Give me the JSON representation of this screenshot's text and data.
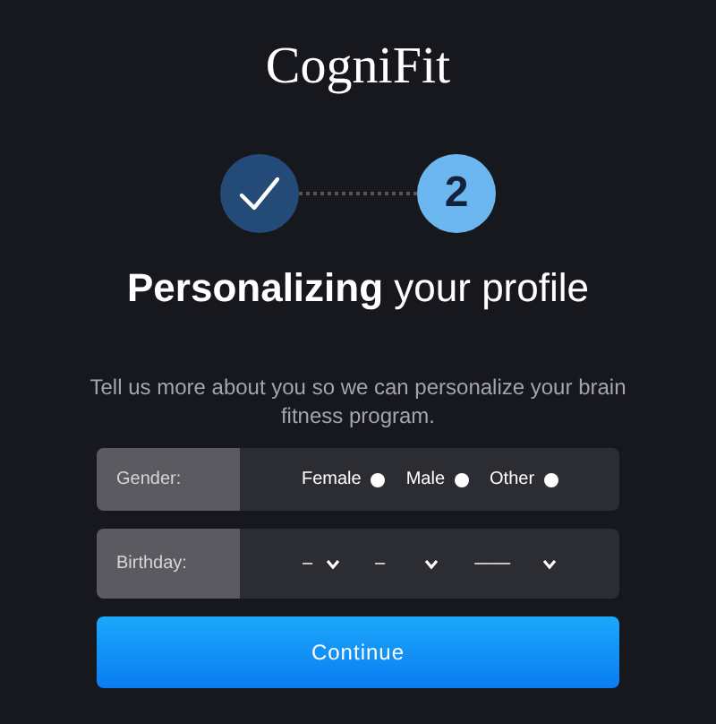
{
  "logo": "CogniFit",
  "steps": [
    {
      "completed": true,
      "selected": false
    },
    {
      "completed": false,
      "label": "2",
      "selected": true
    }
  ],
  "title": {
    "bold": "Personalizing",
    "rest": "your profile"
  },
  "subtitle": "Tell us more about you so we can personalize your brain fitness program.",
  "gender": {
    "label": "Gender:",
    "options": [
      {
        "label": "Female",
        "selected": false
      },
      {
        "label": "Male",
        "selected": false
      },
      {
        "label": "Other",
        "selected": false
      }
    ]
  },
  "birthday": {
    "label": "Birthday:",
    "selects": [
      {
        "value": "–"
      },
      {
        "value": "–"
      },
      {
        "value": "——"
      }
    ]
  },
  "continue_button": "Continue"
}
